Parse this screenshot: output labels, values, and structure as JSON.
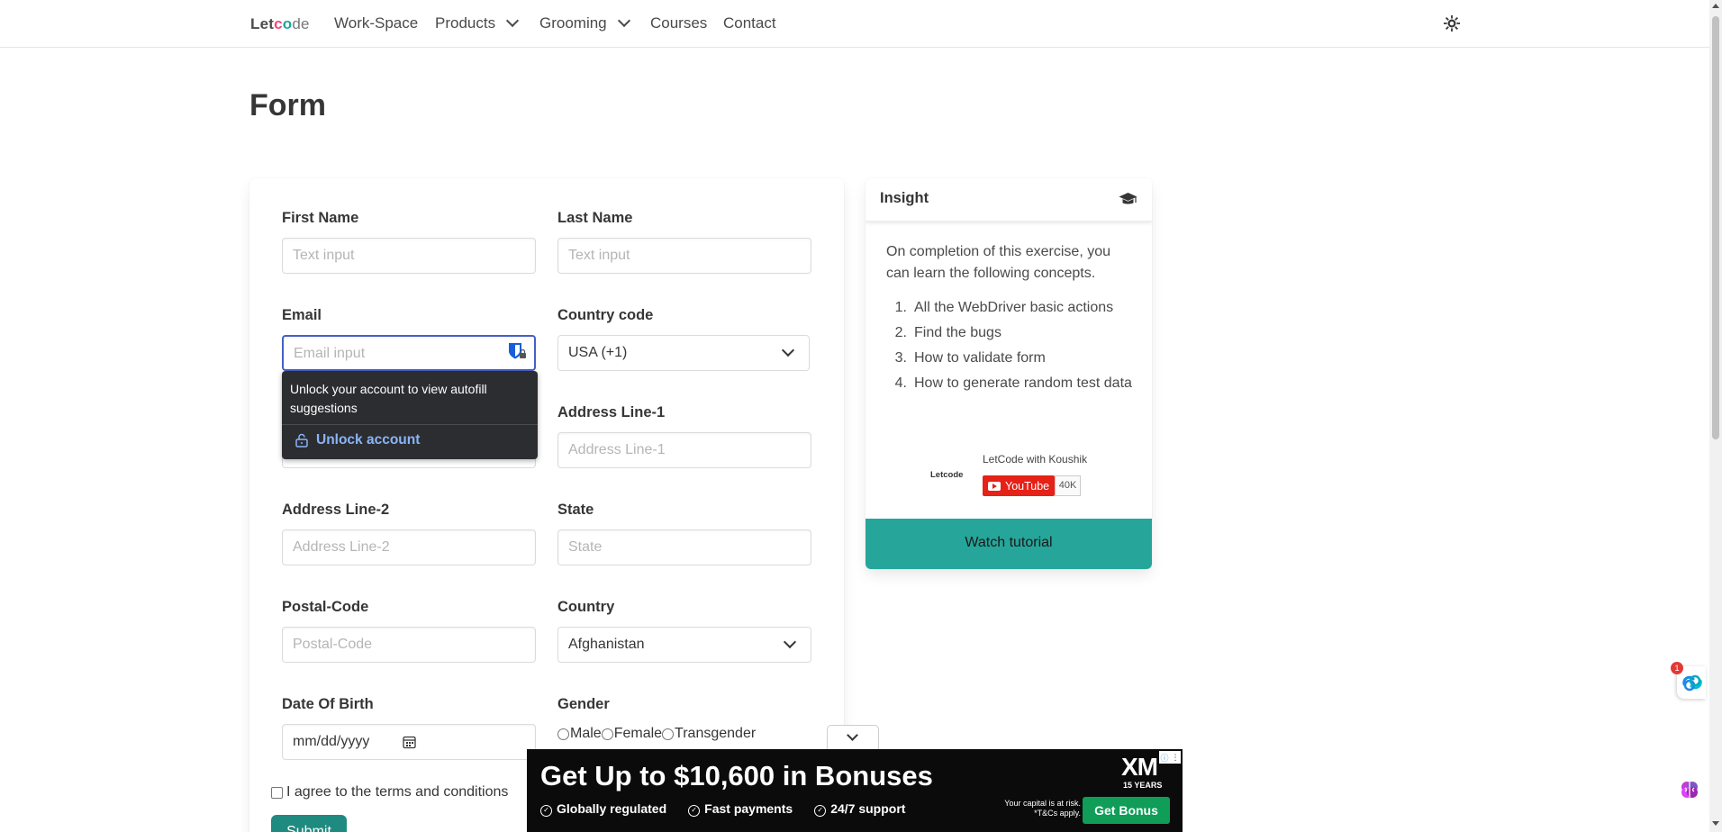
{
  "navbar": {
    "brand": {
      "part1": "Let",
      "part2": "c",
      "part3": "o",
      "part4": "de"
    },
    "items": [
      {
        "label": "Work-Space"
      },
      {
        "label": "Products"
      },
      {
        "label": "Grooming"
      },
      {
        "label": "Courses"
      },
      {
        "label": "Contact"
      }
    ],
    "theme_icon": "sun-gear-icon"
  },
  "page": {
    "title": "Form"
  },
  "form": {
    "first_name": {
      "label": "First Name",
      "placeholder": "Text input"
    },
    "last_name": {
      "label": "Last Name",
      "placeholder": "Text input"
    },
    "email": {
      "label": "Email",
      "placeholder": "Email input"
    },
    "country_code": {
      "label": "Country code",
      "value": "USA (+1)"
    },
    "address1": {
      "label": "Address Line-1",
      "placeholder": "Address Line-1"
    },
    "address2": {
      "label": "Address Line-2",
      "placeholder": "Address Line-2"
    },
    "state": {
      "label": "State",
      "placeholder": "State"
    },
    "postal": {
      "label": "Postal-Code",
      "placeholder": "Postal-Code"
    },
    "country": {
      "label": "Country",
      "value": "Afghanistan"
    },
    "dob": {
      "label": "Date Of Birth",
      "placeholder": "mm/dd/yyyy"
    },
    "gender": {
      "label": "Gender",
      "options": [
        "Male",
        "Female",
        "Transgender"
      ]
    },
    "terms": {
      "label": "I agree to the terms and conditions"
    },
    "submit_label": "Submit"
  },
  "autofill": {
    "message": "Unlock your account to view autofill suggestions",
    "action": "Unlock account"
  },
  "insight": {
    "title": "Insight",
    "intro": "On completion of this exercise, you can learn the following concepts.",
    "items": [
      {
        "num": "1.",
        "text": "All the WebDriver basic actions"
      },
      {
        "num": "2.",
        "text": "Find the bugs"
      },
      {
        "num": "3.",
        "text": "How to validate form"
      },
      {
        "num": "4.",
        "text": "How to generate random test data"
      }
    ],
    "channel": {
      "logo": "Letcode",
      "name": "LetCode with Koushik",
      "button": "YouTube",
      "count": "40K"
    },
    "watch_label": "Watch tutorial"
  },
  "ad": {
    "headline": "Get Up to $10,600 in Bonuses",
    "features": [
      "Globally regulated",
      "Fast payments",
      "24/7 support"
    ],
    "logo": "XM",
    "years": "15 YEARS",
    "disclaimer_1": "Your capital is at risk.",
    "disclaimer_2": "*T&Cs apply.",
    "cta": "Get Bonus"
  },
  "widget": {
    "badge": "1"
  }
}
